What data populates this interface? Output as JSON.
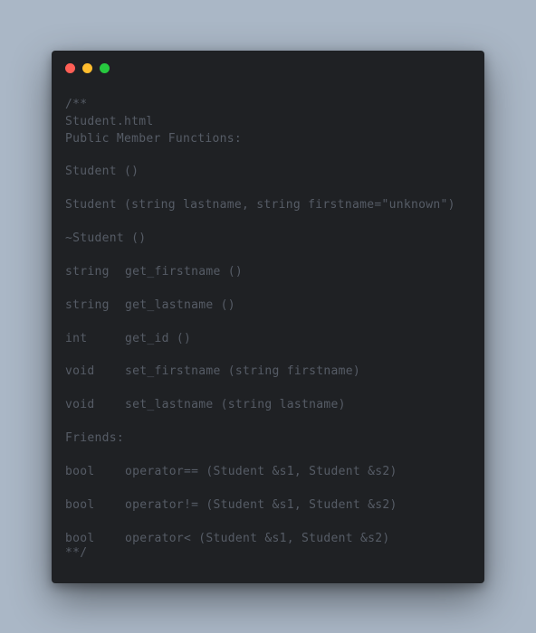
{
  "colors": {
    "background": "#aab7c6",
    "window": "#1f2124",
    "text": "#565c66",
    "close": "#ff5f56",
    "minimize": "#ffbd2e",
    "maximize": "#27c93f"
  },
  "window_controls": [
    "close-icon",
    "minimize-icon",
    "maximize-icon"
  ],
  "code": {
    "open_comment": "/**",
    "filename": "Student.html",
    "public_header": "Public Member Functions:",
    "ctor_default": "Student ()",
    "ctor_params": "Student (string lastname, string firstname=\"unknown\")",
    "dtor": "~Student ()",
    "methods": [
      {
        "type": "string",
        "sig": "get_firstname ()"
      },
      {
        "type": "string",
        "sig": "get_lastname ()"
      },
      {
        "type": "int",
        "sig": "get_id ()"
      },
      {
        "type": "void",
        "sig": "set_firstname (string firstname)"
      },
      {
        "type": "void",
        "sig": "set_lastname (string lastname)"
      }
    ],
    "friends_header": "Friends:",
    "friends": [
      {
        "type": "bool",
        "sig": "operator== (Student &s1, Student &s2)"
      },
      {
        "type": "bool",
        "sig": "operator!= (Student &s1, Student &s2)"
      },
      {
        "type": "bool",
        "sig": "operator< (Student &s1, Student &s2)"
      }
    ],
    "close_comment": "**/"
  }
}
